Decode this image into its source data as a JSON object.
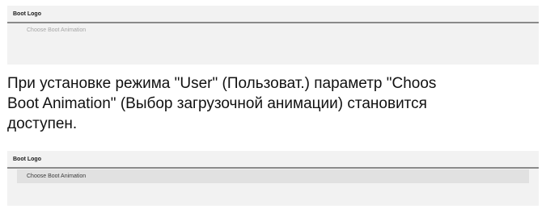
{
  "screenshot_before": {
    "header": "Boot Logo",
    "item_label": "Choose Boot Animation",
    "item_state": "disabled"
  },
  "description": {
    "line1": "При установке режима \"User\" (Пользоват.) параметр \"Choos",
    "line2": "Boot Animation\" (Выбор загрузочной анимации) становится",
    "line3": "доступен."
  },
  "screenshot_after": {
    "header": "Boot Logo",
    "item_label": "Choose Boot Animation",
    "item_state": "enabled"
  },
  "colors": {
    "panel_bg": "#f2f2f2",
    "header_rule": "#8a8a8a",
    "disabled_text": "#a6a6a6",
    "highlight_row": "#e1e1e1"
  }
}
